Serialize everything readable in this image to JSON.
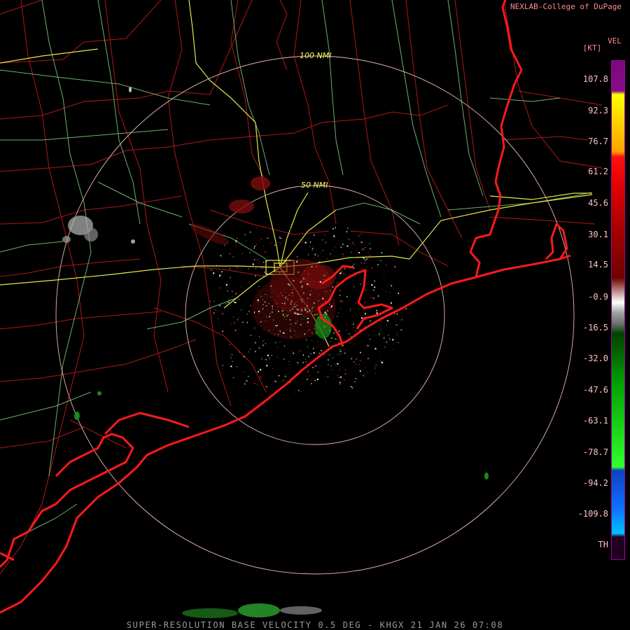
{
  "credit": "NEXLAB-College of DuPage",
  "product": "VEL",
  "units": "[KT]",
  "legend": [
    {
      "value": "107.8"
    },
    {
      "value": "92.3"
    },
    {
      "value": "76.7"
    },
    {
      "value": "61.2"
    },
    {
      "value": "45.6"
    },
    {
      "value": "30.1"
    },
    {
      "value": "14.5"
    },
    {
      "value": "-0.9"
    },
    {
      "value": "-16.5"
    },
    {
      "value": "-32.0"
    },
    {
      "value": "-47.6"
    },
    {
      "value": "-63.1"
    },
    {
      "value": "-78.7"
    },
    {
      "value": "-94.2"
    },
    {
      "value": "-109.8"
    },
    {
      "value": "TH"
    }
  ],
  "range_rings": [
    {
      "label": "100 NMI"
    },
    {
      "label": "50 NMI"
    }
  ],
  "title": "SUPER-RESOLUTION BASE VELOCITY 0.5 DEG - KHGX 21 JAN 26 07:08",
  "colors": {
    "background": "#000000",
    "coastline": "#ff1a1a",
    "county_lines": "#b01818",
    "highways": "#e6e64a",
    "secondary_roads": "#7fcf7f",
    "range_ring": "#e8b8b0",
    "inbound": "#20c020",
    "outbound": "#a01010",
    "near_zero": "#d8d8d8"
  }
}
